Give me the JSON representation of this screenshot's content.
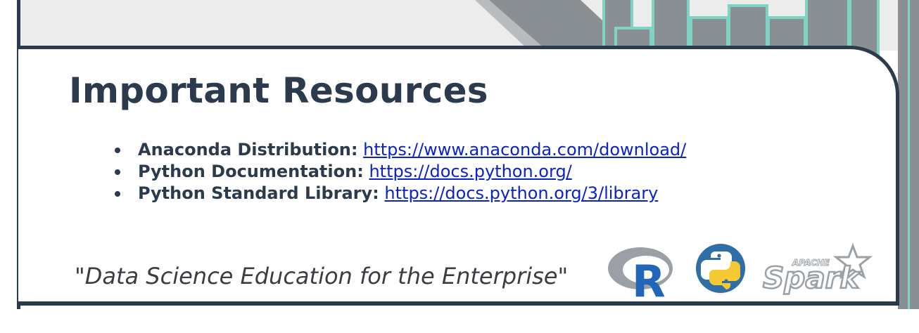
{
  "slide": {
    "title": "Important Resources",
    "resources": [
      {
        "label": "Anaconda Distribution:",
        "url": "https://www.anaconda.com/download/"
      },
      {
        "label": "Python Documentation:",
        "url": "https://docs.python.org/"
      },
      {
        "label": "Python Standard Library:",
        "url": "https://docs.python.org/3/library"
      }
    ],
    "tagline": "\"Data Science Education for the Enterprise\""
  },
  "logos": {
    "r": {
      "icon": "r-logo-icon",
      "letter": "R"
    },
    "python": {
      "icon": "python-logo-icon"
    },
    "spark": {
      "icon": "apache-spark-logo-icon",
      "small_text": "APACHE",
      "word": "Spark"
    }
  },
  "colors": {
    "navy": "#2c3a4d",
    "link": "#0b22c7",
    "deco_gray": "#8a8f94",
    "deco_teal": "#7fd3c3"
  }
}
